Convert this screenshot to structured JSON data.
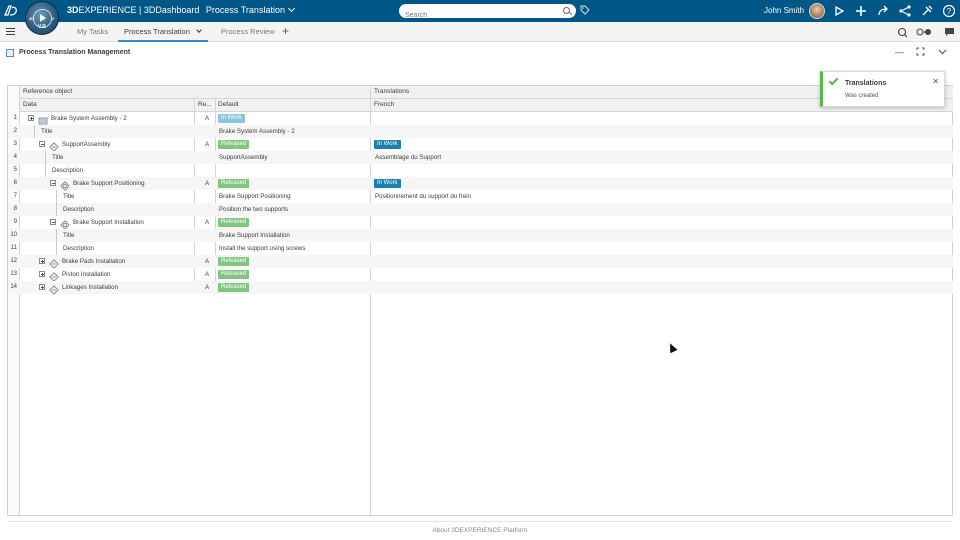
{
  "topbar": {
    "brand_bold": "3D",
    "brand_rest": "EXPERIENCE | 3DDashboard",
    "dashboard_name": "Process Translation",
    "search_placeholder": "Search",
    "user_name": "John Smith",
    "compass_version": "V.R",
    "compass_3d": "3D",
    "compass_v": "V",
    "icons": [
      "play-icon",
      "add-icon",
      "share-icon",
      "network-icon",
      "tools-icon",
      "help-icon"
    ]
  },
  "tabs": {
    "items": [
      "My Tasks",
      "Process Translation",
      "Process Review"
    ],
    "active_index": 1
  },
  "widget": {
    "title": "Process Translation Management"
  },
  "grid": {
    "group_headers": {
      "reference": "Reference object",
      "translations": "Translations"
    },
    "columns": {
      "data": "Data",
      "revision": "Re...",
      "default": "Default",
      "french": "French"
    },
    "rows": [
      {
        "n": "1",
        "label": "Brake System Assembly - 2",
        "rev": "A",
        "default": "",
        "status": "In Work",
        "status_type": "inwork-grey",
        "french": "",
        "fstatus": ""
      },
      {
        "n": "2",
        "label": "Title",
        "rev": "",
        "default": "Brake System Assembly - 2",
        "status": "",
        "french": "",
        "fstatus": ""
      },
      {
        "n": "3",
        "label": "SupportAssembly",
        "rev": "A",
        "default": "",
        "status": "Released",
        "status_type": "released",
        "french": "",
        "fstatus": "In Work"
      },
      {
        "n": "4",
        "label": "Title",
        "rev": "",
        "default": "SupportAssembly",
        "status": "",
        "french": "Assemblage du Support",
        "fstatus": ""
      },
      {
        "n": "5",
        "label": "Description",
        "rev": "",
        "default": "",
        "status": "",
        "french": "",
        "fstatus": ""
      },
      {
        "n": "6",
        "label": "Brake Support Positioning",
        "rev": "A",
        "default": "",
        "status": "Released",
        "status_type": "released",
        "french": "",
        "fstatus": "In Work"
      },
      {
        "n": "7",
        "label": "Title",
        "rev": "",
        "default": "Brake Support Positioning",
        "status": "",
        "french": "Positionnement du support du frein",
        "fstatus": ""
      },
      {
        "n": "8",
        "label": "Description",
        "rev": "",
        "default": "Position the two supports",
        "status": "",
        "french": "",
        "fstatus": ""
      },
      {
        "n": "9",
        "label": "Brake Support Installation",
        "rev": "A",
        "default": "",
        "status": "Released",
        "status_type": "released",
        "french": "",
        "fstatus": ""
      },
      {
        "n": "10",
        "label": "Title",
        "rev": "",
        "default": "Brake Support Installation",
        "status": "",
        "french": "",
        "fstatus": ""
      },
      {
        "n": "11",
        "label": "Description",
        "rev": "",
        "default": "Install the support using screws",
        "status": "",
        "french": "",
        "fstatus": ""
      },
      {
        "n": "12",
        "label": "Brake Pads Installation",
        "rev": "A",
        "default": "",
        "status": "Released",
        "status_type": "released",
        "french": "",
        "fstatus": ""
      },
      {
        "n": "13",
        "label": "Piston Installation",
        "rev": "A",
        "default": "",
        "status": "Released",
        "status_type": "released",
        "french": "",
        "fstatus": ""
      },
      {
        "n": "14",
        "label": "Linkages Installation",
        "rev": "A",
        "default": "",
        "status": "Released",
        "status_type": "released",
        "french": "",
        "fstatus": ""
      }
    ]
  },
  "toast": {
    "title": "Translations",
    "message": "Was created"
  },
  "footer": {
    "text": "About 3DEXPERIENCE Platform"
  },
  "colors": {
    "topbar": "#005686",
    "released": "#80c580",
    "inwork": "#1e7fad",
    "success": "#57b847"
  }
}
